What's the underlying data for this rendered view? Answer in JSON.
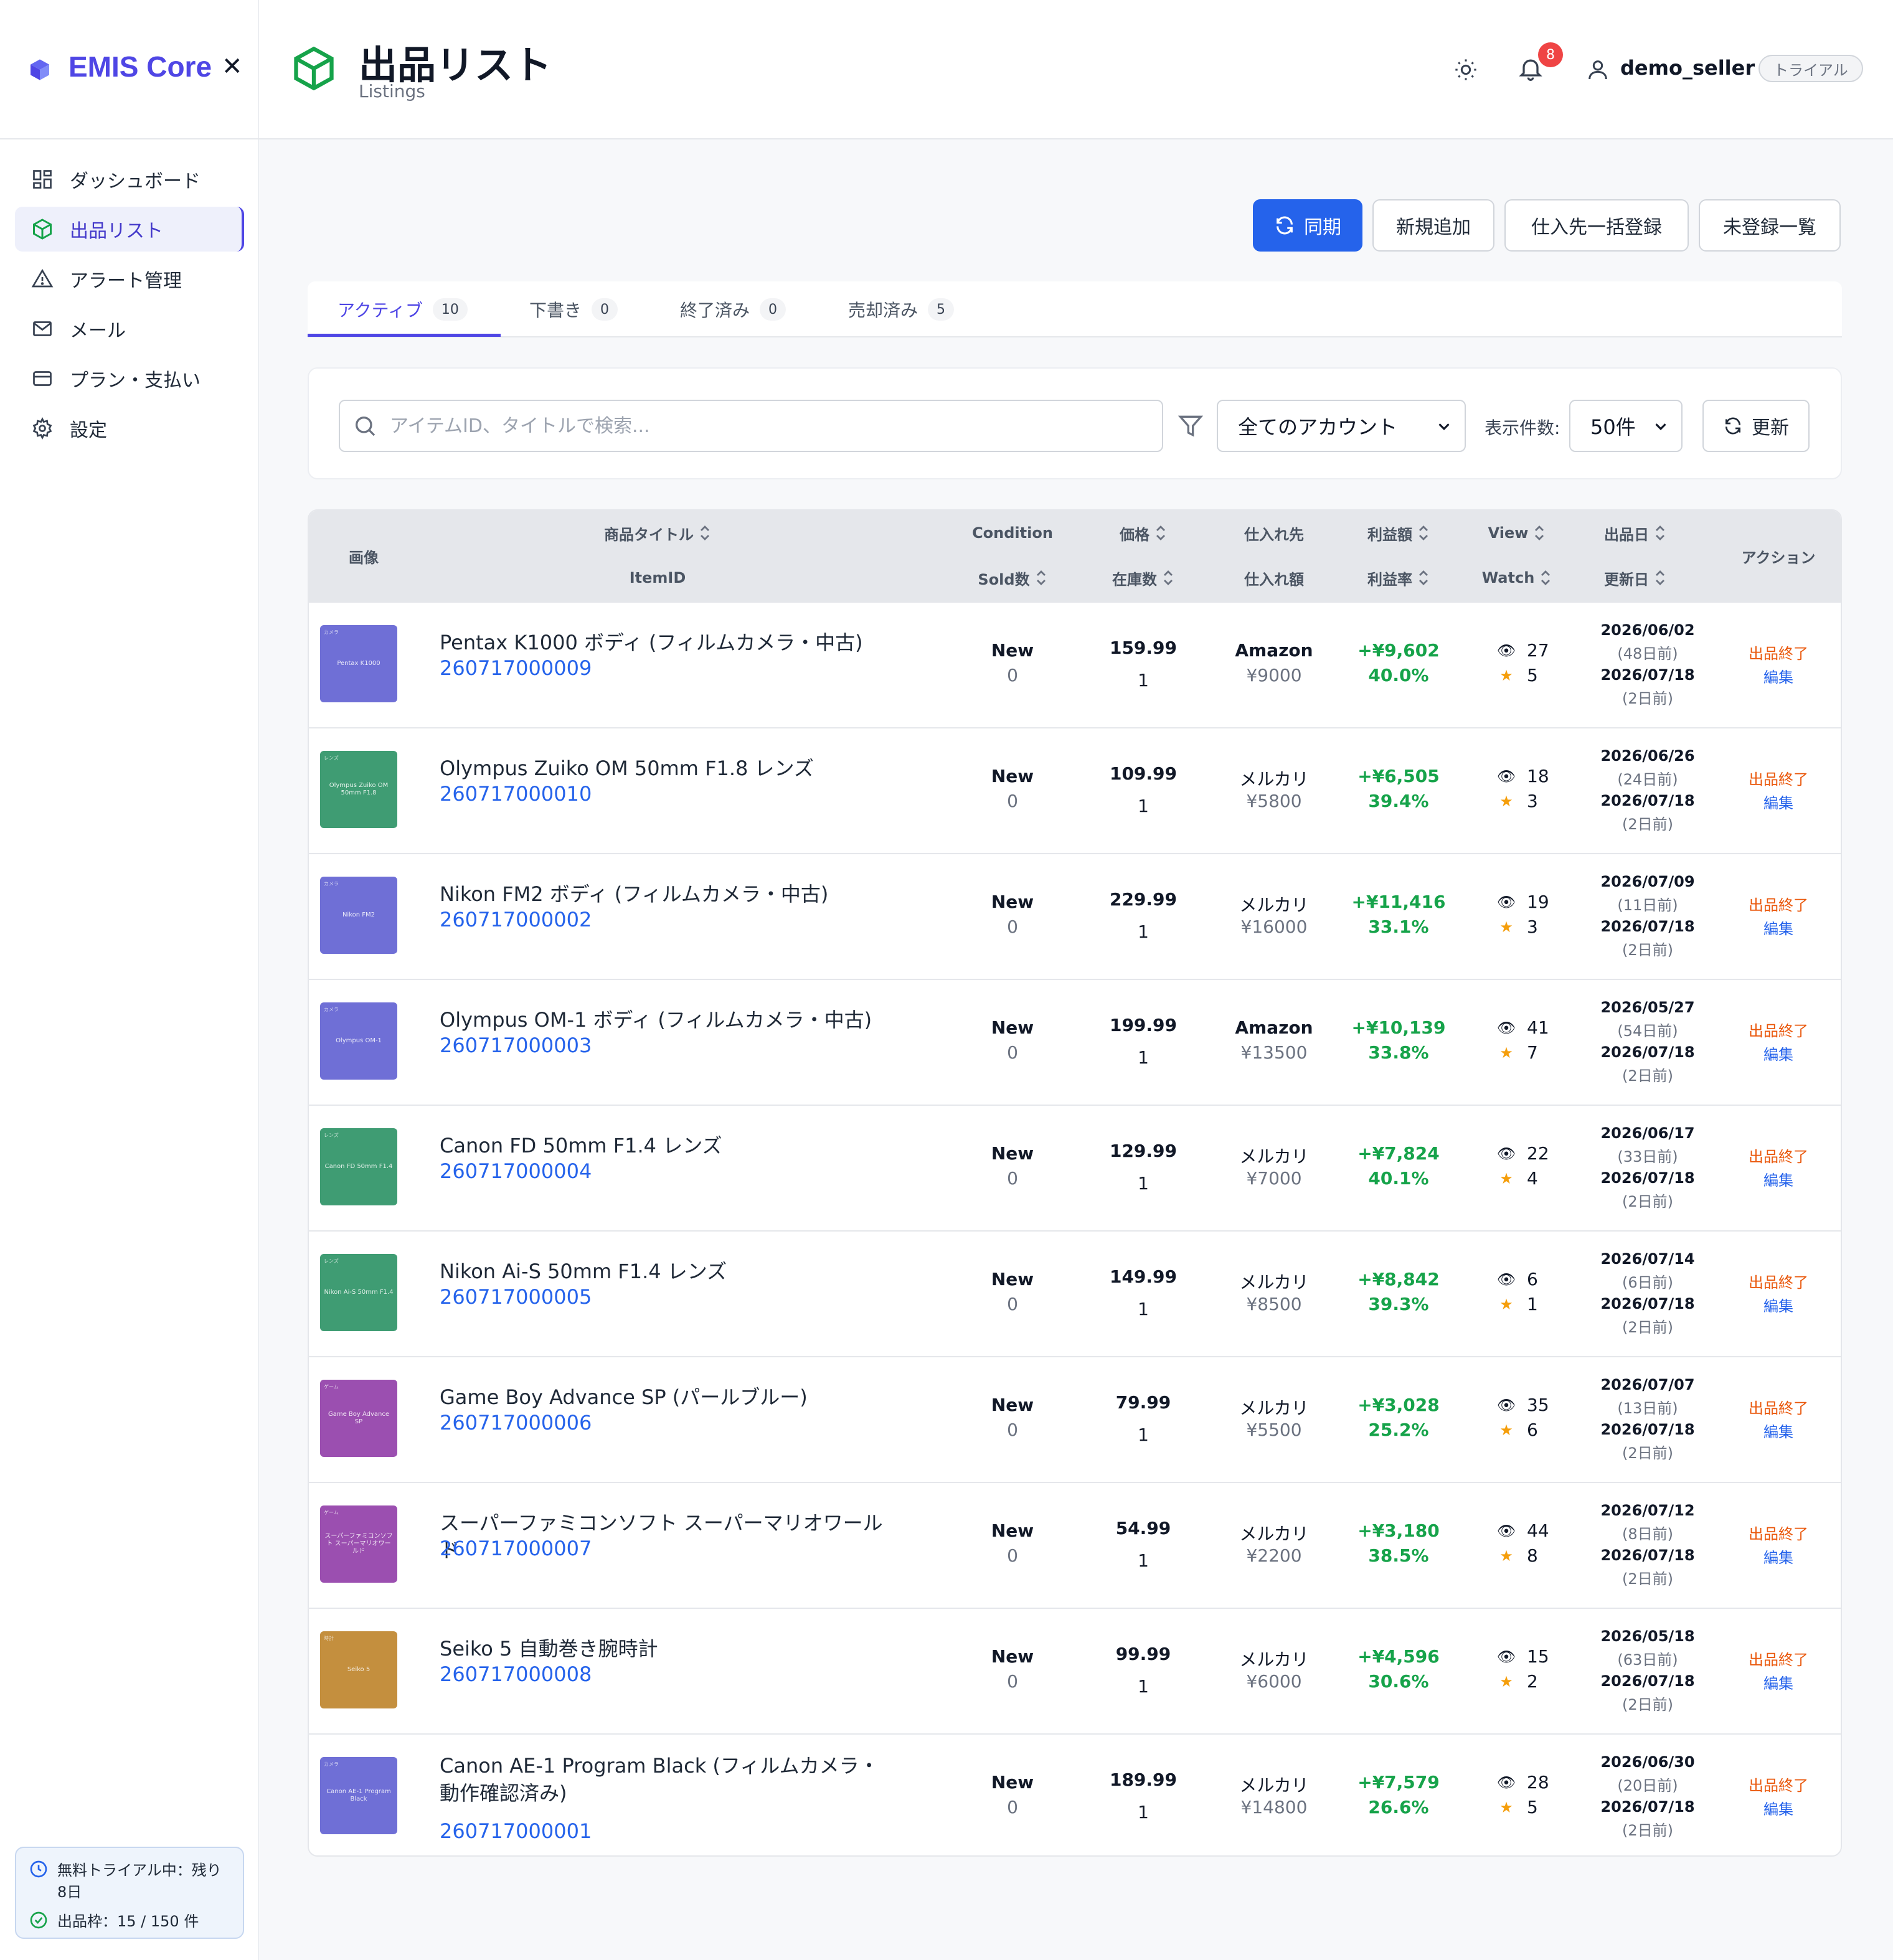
{
  "app": {
    "name": "EMIS Core"
  },
  "sidebar": {
    "items": [
      {
        "label": "ダッシュボード",
        "icon": "grid-icon"
      },
      {
        "label": "出品リスト",
        "icon": "box-icon",
        "active": true
      },
      {
        "label": "アラート管理",
        "icon": "alert-triangle-icon"
      },
      {
        "label": "メール",
        "icon": "mail-icon"
      },
      {
        "label": "プラン・支払い",
        "icon": "credit-card-icon"
      },
      {
        "label": "設定",
        "icon": "gear-icon"
      }
    ],
    "trial": {
      "line1": "無料トライアル中：残り8日",
      "line2": "出品枠：15 / 150 件"
    }
  },
  "header": {
    "title": "出品リスト",
    "subtitle": "Listings",
    "notifications": "8",
    "user": "demo_seller",
    "plan_badge": "トライアル"
  },
  "actions": {
    "sync": "同期",
    "add": "新規追加",
    "bulk_supplier": "仕入先一括登録",
    "unregistered": "未登録一覧"
  },
  "tabs": [
    {
      "label": "アクティブ",
      "count": "10",
      "active": true
    },
    {
      "label": "下書き",
      "count": "0"
    },
    {
      "label": "終了済み",
      "count": "0"
    },
    {
      "label": "売却済み",
      "count": "5"
    }
  ],
  "filters": {
    "search_placeholder": "アイテムID、タイトルで検索...",
    "account_select": "全てのアカウント",
    "count_label": "表示件数:",
    "count_select": "50件",
    "refresh": "更新"
  },
  "table": {
    "headers": {
      "image": "画像",
      "title": "商品タイトル",
      "item_id": "ItemID",
      "condition": "Condition",
      "sold": "Sold数",
      "price": "価格",
      "stock": "在庫数",
      "supplier": "仕入れ先",
      "cost": "仕入れ額",
      "profit": "利益額",
      "margin": "利益率",
      "view": "View",
      "watch": "Watch",
      "listed": "出品日",
      "updated": "更新日",
      "action": "アクション"
    },
    "end_label": "出品終了",
    "edit_label": "編集",
    "rows": [
      {
        "thumb_color": "#6f6fd6",
        "thumb_cat": "カメラ",
        "thumb_text": "Pentax K1000",
        "title": "Pentax K1000 ボディ (フィルムカメラ・中古)",
        "item_id": "260717000009",
        "condition": "New",
        "sold": "0",
        "price": "159.99",
        "stock": "1",
        "supplier": "Amazon",
        "cost": "¥9000",
        "profit": "+¥9,602",
        "margin": "40.0%",
        "view": "27",
        "watch": "5",
        "listed": "2026/06/02",
        "listed_ago": "(48日前)",
        "updated": "2026/07/18",
        "updated_ago": "(2日前)"
      },
      {
        "thumb_color": "#3f9c73",
        "thumb_cat": "レンズ",
        "thumb_text": "Olympus Zuiko OM 50mm F1.8",
        "title": "Olympus Zuiko OM 50mm F1.8 レンズ",
        "item_id": "260717000010",
        "condition": "New",
        "sold": "0",
        "price": "109.99",
        "stock": "1",
        "supplier": "メルカリ",
        "cost": "¥5800",
        "profit": "+¥6,505",
        "margin": "39.4%",
        "view": "18",
        "watch": "3",
        "listed": "2026/06/26",
        "listed_ago": "(24日前)",
        "updated": "2026/07/18",
        "updated_ago": "(2日前)"
      },
      {
        "thumb_color": "#6f6fd6",
        "thumb_cat": "カメラ",
        "thumb_text": "Nikon FM2",
        "title": "Nikon FM2 ボディ (フィルムカメラ・中古)",
        "item_id": "260717000002",
        "condition": "New",
        "sold": "0",
        "price": "229.99",
        "stock": "1",
        "supplier": "メルカリ",
        "cost": "¥16000",
        "profit": "+¥11,416",
        "margin": "33.1%",
        "view": "19",
        "watch": "3",
        "listed": "2026/07/09",
        "listed_ago": "(11日前)",
        "updated": "2026/07/18",
        "updated_ago": "(2日前)"
      },
      {
        "thumb_color": "#6f6fd6",
        "thumb_cat": "カメラ",
        "thumb_text": "Olympus OM-1",
        "title": "Olympus OM-1 ボディ (フィルムカメラ・中古)",
        "item_id": "260717000003",
        "condition": "New",
        "sold": "0",
        "price": "199.99",
        "stock": "1",
        "supplier": "Amazon",
        "cost": "¥13500",
        "profit": "+¥10,139",
        "margin": "33.8%",
        "view": "41",
        "watch": "7",
        "listed": "2026/05/27",
        "listed_ago": "(54日前)",
        "updated": "2026/07/18",
        "updated_ago": "(2日前)"
      },
      {
        "thumb_color": "#3f9c73",
        "thumb_cat": "レンズ",
        "thumb_text": "Canon FD 50mm F1.4",
        "title": "Canon FD 50mm F1.4 レンズ",
        "item_id": "260717000004",
        "condition": "New",
        "sold": "0",
        "price": "129.99",
        "stock": "1",
        "supplier": "メルカリ",
        "cost": "¥7000",
        "profit": "+¥7,824",
        "margin": "40.1%",
        "view": "22",
        "watch": "4",
        "listed": "2026/06/17",
        "listed_ago": "(33日前)",
        "updated": "2026/07/18",
        "updated_ago": "(2日前)"
      },
      {
        "thumb_color": "#3f9c73",
        "thumb_cat": "レンズ",
        "thumb_text": "Nikon Ai-S 50mm F1.4",
        "title": "Nikon Ai-S 50mm F1.4 レンズ",
        "item_id": "260717000005",
        "condition": "New",
        "sold": "0",
        "price": "149.99",
        "stock": "1",
        "supplier": "メルカリ",
        "cost": "¥8500",
        "profit": "+¥8,842",
        "margin": "39.3%",
        "view": "6",
        "watch": "1",
        "listed": "2026/07/14",
        "listed_ago": "(6日前)",
        "updated": "2026/07/18",
        "updated_ago": "(2日前)"
      },
      {
        "thumb_color": "#9b4fb0",
        "thumb_cat": "ゲーム",
        "thumb_text": "Game Boy Advance SP",
        "title": "Game Boy Advance SP (パールブルー)",
        "item_id": "260717000006",
        "condition": "New",
        "sold": "0",
        "price": "79.99",
        "stock": "1",
        "supplier": "メルカリ",
        "cost": "¥5500",
        "profit": "+¥3,028",
        "margin": "25.2%",
        "view": "35",
        "watch": "6",
        "listed": "2026/07/07",
        "listed_ago": "(13日前)",
        "updated": "2026/07/18",
        "updated_ago": "(2日前)"
      },
      {
        "thumb_color": "#9b4fb0",
        "thumb_cat": "ゲーム",
        "thumb_text": "スーパーファミコンソフト スーパーマリオワールド",
        "title": "スーパーファミコンソフト スーパーマリオワールド",
        "item_id": "260717000007",
        "condition": "New",
        "sold": "0",
        "price": "54.99",
        "stock": "1",
        "supplier": "メルカリ",
        "cost": "¥2200",
        "profit": "+¥3,180",
        "margin": "38.5%",
        "view": "44",
        "watch": "8",
        "listed": "2026/07/12",
        "listed_ago": "(8日前)",
        "updated": "2026/07/18",
        "updated_ago": "(2日前)"
      },
      {
        "thumb_color": "#c48f3e",
        "thumb_cat": "時計",
        "thumb_text": "Seiko 5",
        "title": "Seiko 5 自動巻き腕時計",
        "item_id": "260717000008",
        "condition": "New",
        "sold": "0",
        "price": "99.99",
        "stock": "1",
        "supplier": "メルカリ",
        "cost": "¥6000",
        "profit": "+¥4,596",
        "margin": "30.6%",
        "view": "15",
        "watch": "2",
        "listed": "2026/05/18",
        "listed_ago": "(63日前)",
        "updated": "2026/07/18",
        "updated_ago": "(2日前)"
      },
      {
        "thumb_color": "#6f6fd6",
        "thumb_cat": "カメラ",
        "thumb_text": "Canon AE-1 Program Black",
        "title": "Canon AE-1 Program Black (フィルムカメラ・動作確認済み)",
        "item_id": "260717000001",
        "condition": "New",
        "sold": "0",
        "price": "189.99",
        "stock": "1",
        "supplier": "メルカリ",
        "cost": "¥14800",
        "profit": "+¥7,579",
        "margin": "26.6%",
        "view": "28",
        "watch": "5",
        "listed": "2026/06/30",
        "listed_ago": "(20日前)",
        "updated": "2026/07/18",
        "updated_ago": "(2日前)"
      }
    ]
  },
  "colors": {
    "brand": "#4f46e5",
    "primary": "#2563eb",
    "profit": "#16a34a",
    "end": "#ea580c",
    "badge": "#ef4444"
  }
}
